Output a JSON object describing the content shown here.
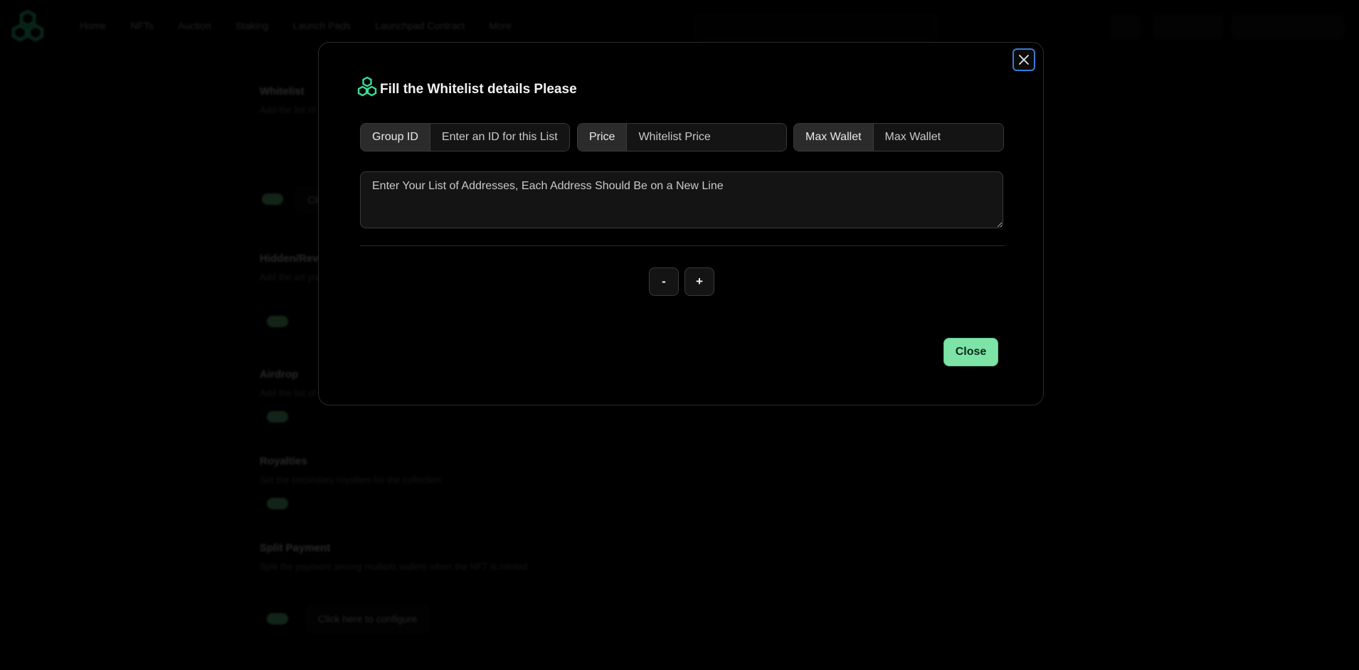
{
  "background": {
    "nav_items": [
      "Home",
      "NFTs",
      "Auction",
      "Staking",
      "Launch Pads",
      "Launchpad Contract",
      "More"
    ],
    "sections": [
      {
        "heading": "Whitelist",
        "desc": "Add the list of addresses that can mint before public sale"
      },
      {
        "heading": "Hidden/Reveal",
        "desc": "Add the art you would like to display before reveal"
      },
      {
        "heading": "Airdrop",
        "desc": "Add the list of addresses to airdrop NFTs"
      },
      {
        "heading": "Royalties",
        "desc": "Set the secondary royalties for the collection"
      },
      {
        "heading": "Split Payment",
        "desc": "Split the payment among multiple wallets when the NFT is minted"
      }
    ],
    "configure_label": "Click here to configure"
  },
  "modal": {
    "close_icon": "close-icon",
    "title": "Fill the Whitelist details Please",
    "group_id": {
      "label": "Group ID",
      "placeholder": "Enter an ID for this List",
      "value": ""
    },
    "price": {
      "label": "Price",
      "placeholder": "Whitelist Price",
      "value": ""
    },
    "max_wallet": {
      "label": "Max Wallet",
      "placeholder": "Max Wallet",
      "value": ""
    },
    "addresses": {
      "placeholder": "Enter Your List of Addresses, Each Address Should Be on a New Line",
      "value": ""
    },
    "minus_label": "-",
    "plus_label": "+",
    "close_label": "Close"
  },
  "colors": {
    "accent_green": "#7ee3a6",
    "logo_green": "#3ddc97",
    "focus_blue": "#3a7bd5"
  }
}
